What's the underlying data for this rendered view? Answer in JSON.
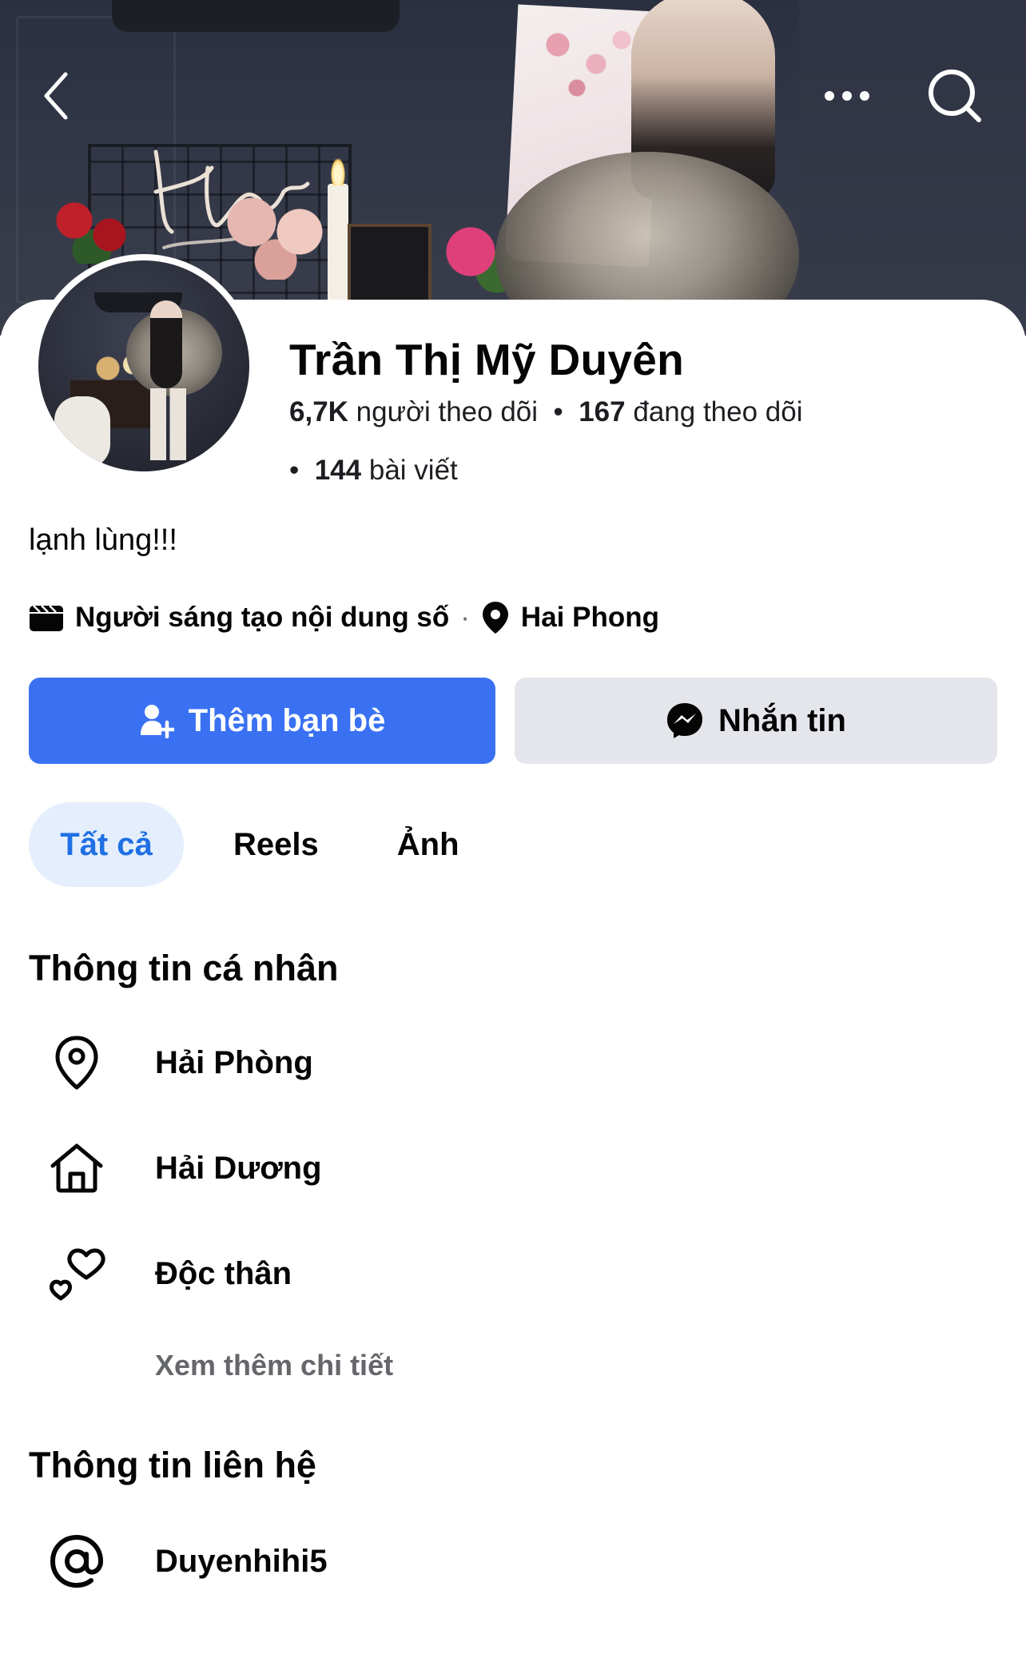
{
  "profile": {
    "name": "Trần Thị Mỹ Duyên",
    "followers_count": "6,7K",
    "followers_label": "người theo dõi",
    "following_count": "167",
    "following_label": "đang theo dõi",
    "posts_count": "144",
    "posts_label": "bài viết",
    "bio": "lạnh lùng!!!",
    "category": "Người sáng tạo nội dung số",
    "location": "Hai Phong"
  },
  "actions": {
    "add_friend_label": "Thêm bạn bè",
    "message_label": "Nhắn tin"
  },
  "tabs": [
    {
      "label": "Tất cả",
      "active": true
    },
    {
      "label": "Reels",
      "active": false
    },
    {
      "label": "Ảnh",
      "active": false
    }
  ],
  "personal_info": {
    "title": "Thông tin cá nhân",
    "items": [
      {
        "icon": "location-pin-icon",
        "label": "Hải Phòng"
      },
      {
        "icon": "home-icon",
        "label": "Hải Dương"
      },
      {
        "icon": "hearts-icon",
        "label": "Độc thân"
      }
    ],
    "see_more_label": "Xem thêm chi tiết"
  },
  "contact_info": {
    "title": "Thông tin liên hệ",
    "items": [
      {
        "icon": "at-sign-icon",
        "label": "Duyenhihi5"
      }
    ]
  },
  "colors": {
    "primary": "#3a71f3",
    "secondary_button": "#e4e6eb",
    "tab_active_bg": "#e4eefc",
    "tab_active_text": "#1f6fe5",
    "muted_text": "#65676b"
  }
}
